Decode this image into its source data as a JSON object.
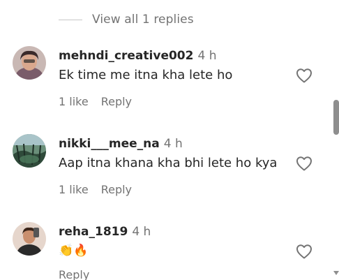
{
  "view_replies": {
    "label": "View all 1 replies"
  },
  "comments": [
    {
      "username": "mehndi_creative002",
      "time": "4 h",
      "text": "Ek time me itna kha lete ho",
      "likes": "1 like",
      "reply_label": "Reply"
    },
    {
      "username": "nikki___mee_na",
      "time": "4 h",
      "text": "Aap itna khana kha bhi lete ho kya",
      "likes": "1 like",
      "reply_label": "Reply"
    },
    {
      "username": "reha_1819",
      "time": "4 h",
      "text_emojis": [
        "👏",
        "🔥"
      ],
      "reply_label": "Reply"
    }
  ],
  "colors": {
    "text_primary": "#262626",
    "text_secondary": "#737373",
    "heart_outline": "#737373",
    "scrollbar": "#8e8e8e"
  },
  "icons": [
    "heart-outline-icon",
    "scroll-down-arrow-icon"
  ]
}
